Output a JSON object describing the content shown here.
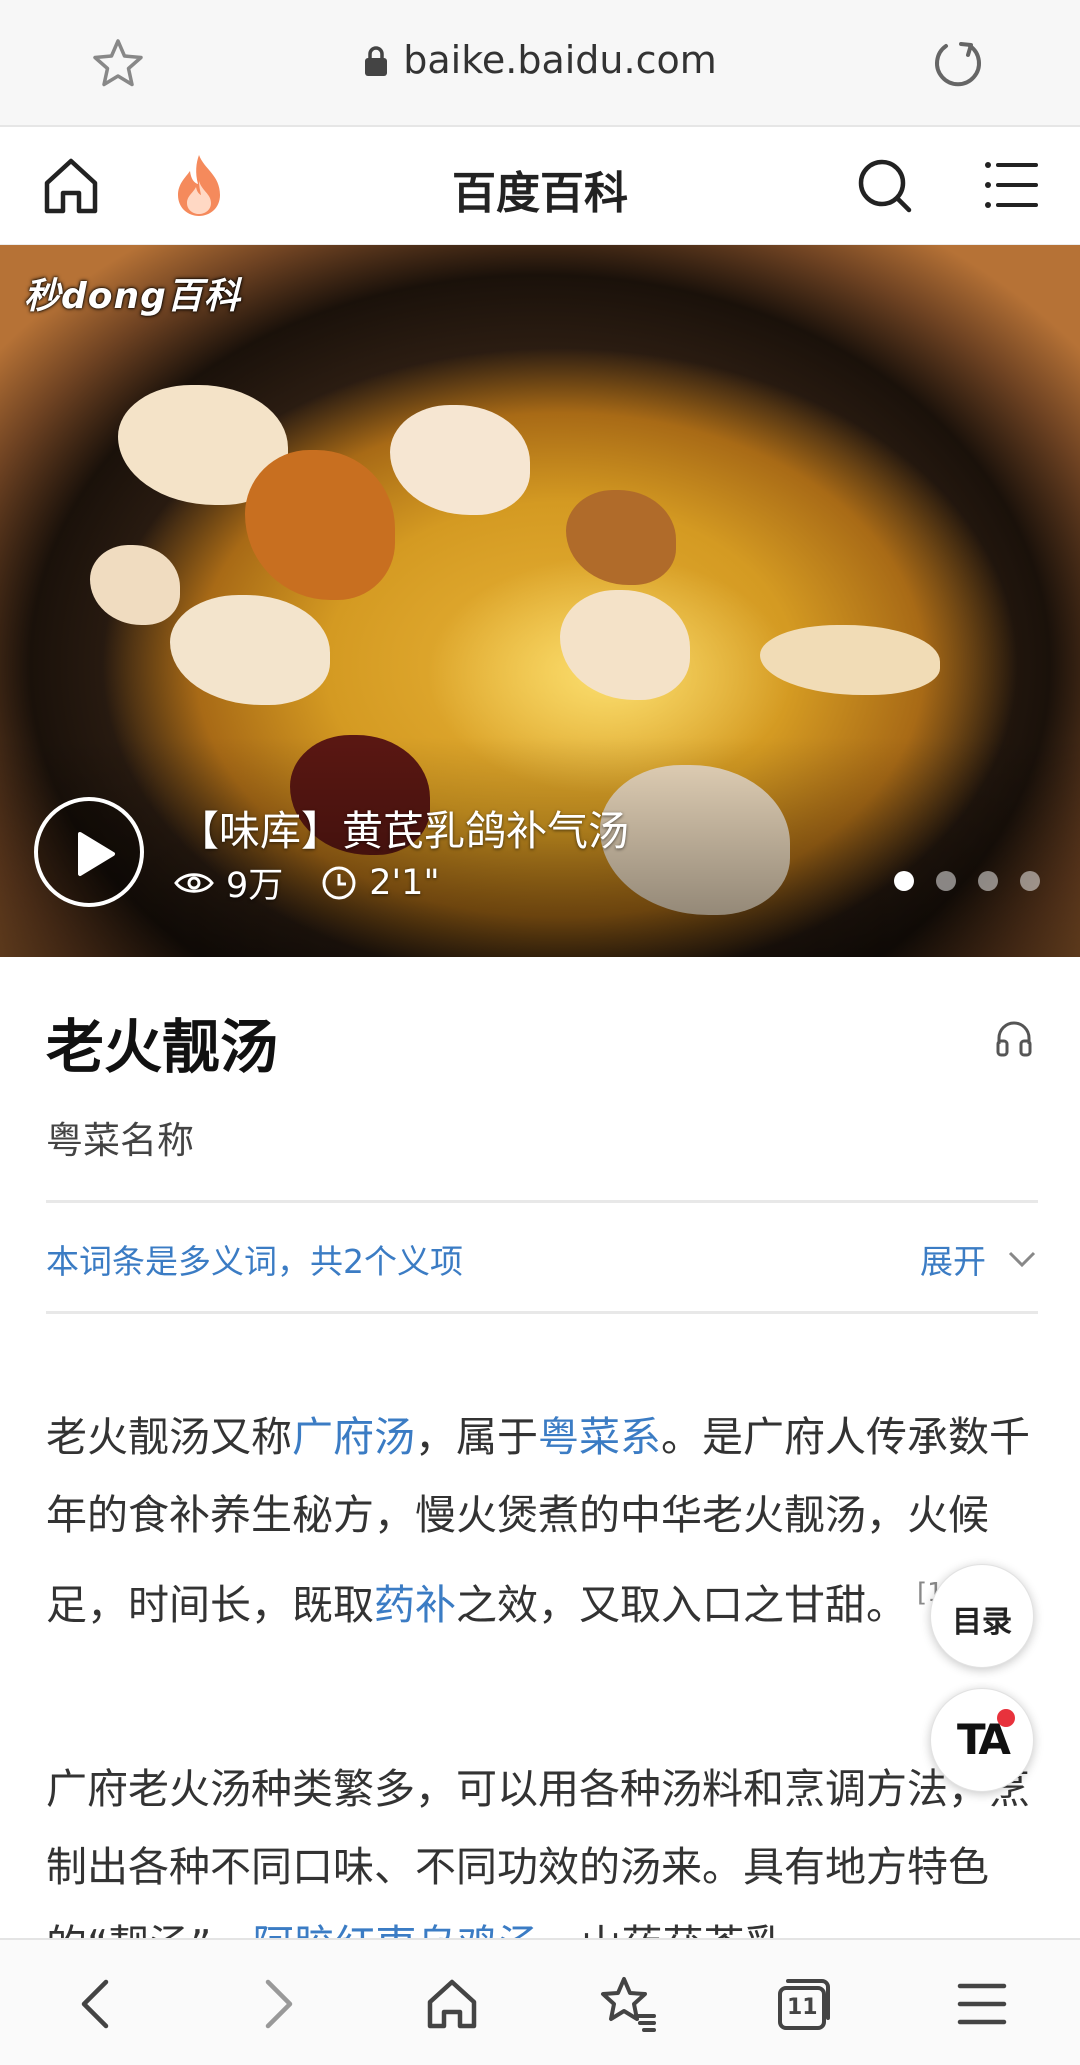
{
  "browser": {
    "url": "baike.baidu.com",
    "icons": [
      "star-outline-icon",
      "lock-icon",
      "reload-icon"
    ]
  },
  "site_header": {
    "brand": "百度百科",
    "icons": [
      "home-icon",
      "fire-icon",
      "search-icon",
      "menu-icon"
    ],
    "accent_color": "#f26b3a"
  },
  "hero": {
    "watermark": "秒dong百科",
    "video_title": "【味库】黄芪乳鸽补气汤",
    "views": "9万",
    "duration": "2'1\"",
    "slides_total": 4,
    "active_slide": 1
  },
  "article": {
    "title": "老火靓汤",
    "subtitle": "粤菜名称",
    "polysemy_notice": "本词条是多义词，共2个义项",
    "expand_label": "展开",
    "link_color": "#3b7cc4",
    "p1": {
      "t1": "老火靓汤又称",
      "link1": "广府汤",
      "t2": "，属于",
      "link2": "粤菜系",
      "t3": "。是广府人传承数千年的食补养生秘方，慢火煲煮的中华老火靓汤，火候足，时间长，既取",
      "link3": "药补",
      "t4": "之效，又取入口之甘甜。",
      "ref": "[1]"
    },
    "p2": {
      "t1": "广府老火汤种类繁多，可以用各种汤料和烹调方法，烹制出各种不同口味、不同功效的汤来。具有地方特色的“靓汤”，",
      "link1": "阿胶红枣乌鸡汤",
      "t2": "、山药茯苓乳"
    }
  },
  "floating": {
    "toc_label": "目录",
    "ta_label": "TA"
  },
  "toolbar": {
    "icons": [
      "back-icon",
      "forward-icon",
      "home-icon",
      "bookmarks-icon",
      "tabs-icon",
      "menu-icon"
    ],
    "tabs_count": "11"
  }
}
